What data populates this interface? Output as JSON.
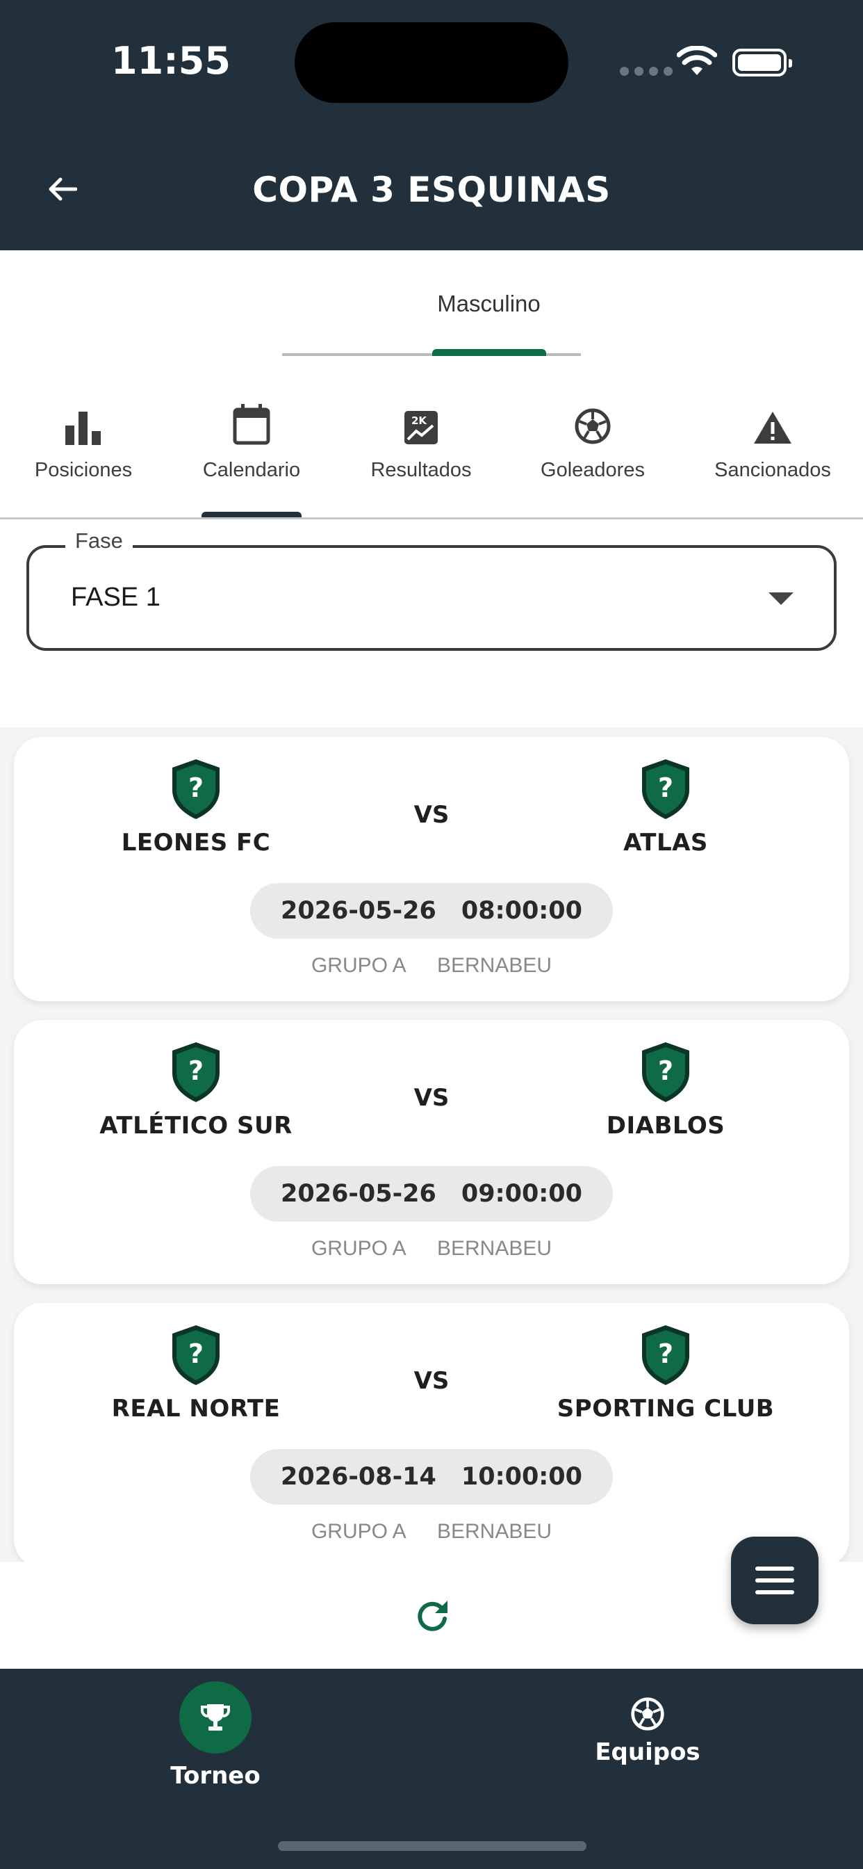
{
  "status_bar": {
    "time": "11:55"
  },
  "header": {
    "title": "COPA 3 ESQUINAS"
  },
  "gender_tabs": [
    {
      "label": "Masculino",
      "active": true
    }
  ],
  "category_tabs": [
    {
      "label": "Posiciones",
      "icon": "bar-chart-icon",
      "active": false
    },
    {
      "label": "Calendario",
      "icon": "calendar-icon",
      "active": true
    },
    {
      "label": "Resultados",
      "icon": "results-icon",
      "active": false
    },
    {
      "label": "Goleadores",
      "icon": "soccer-ball-icon",
      "active": false
    },
    {
      "label": "Sancionados",
      "icon": "warning-icon",
      "active": false
    }
  ],
  "fase_select": {
    "label": "Fase",
    "value": "FASE 1"
  },
  "matches": [
    {
      "home": "LEONES FC",
      "away": "ATLAS",
      "vs": "VS",
      "date": "2026-05-26",
      "time": "08:00:00",
      "group": "GRUPO A",
      "venue": "BERNABEU"
    },
    {
      "home": "ATLÉTICO SUR",
      "away": "DIABLOS",
      "vs": "VS",
      "date": "2026-05-26",
      "time": "09:00:00",
      "group": "GRUPO A",
      "venue": "BERNABEU"
    },
    {
      "home": "REAL NORTE",
      "away": "SPORTING CLUB",
      "vs": "VS",
      "date": "2026-08-14",
      "time": "10:00:00",
      "group": "GRUPO A",
      "venue": "BERNABEU"
    }
  ],
  "bottom_nav": [
    {
      "label": "Torneo",
      "icon": "trophy-icon",
      "active": true
    },
    {
      "label": "Equipos",
      "icon": "soccer-ball-icon",
      "active": false
    }
  ],
  "colors": {
    "header_bg": "#21303b",
    "accent_green": "#0e6b45",
    "shield_dark": "#0f3b2c"
  }
}
